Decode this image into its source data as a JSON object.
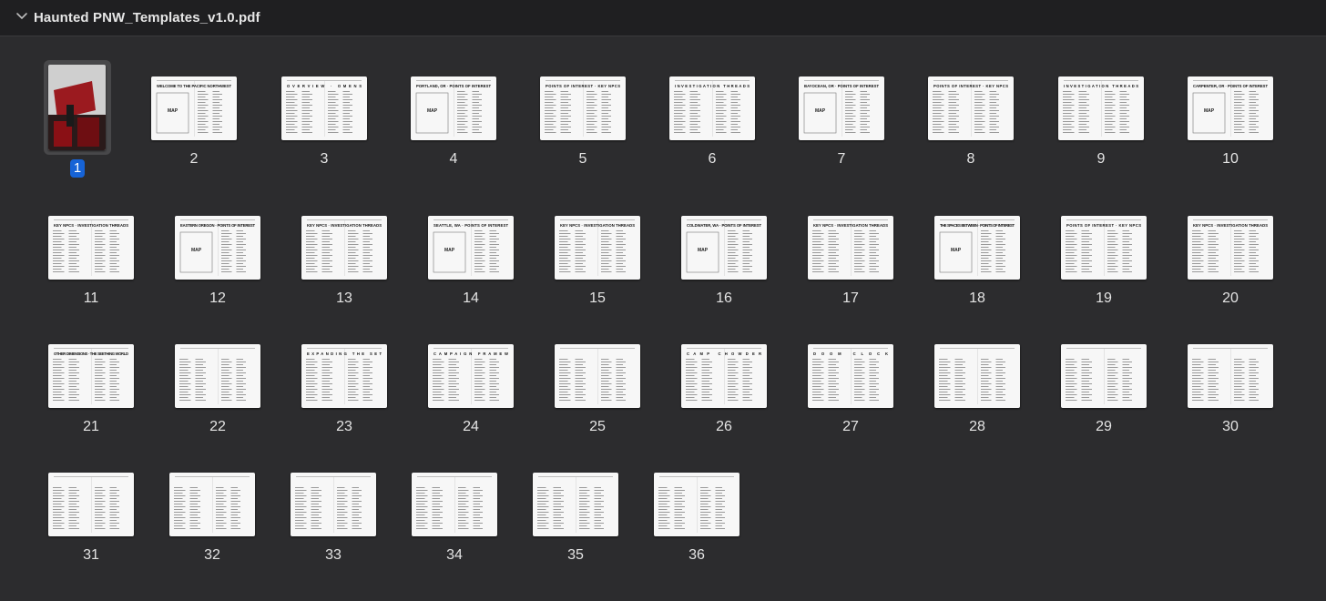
{
  "header": {
    "title": "Haunted PNW_Templates_v1.0.pdf"
  },
  "selected_page": "1",
  "pages": [
    {
      "label": "1",
      "heading": "",
      "map": false
    },
    {
      "label": "2",
      "heading": "WELCOME TO THE PACIFIC NORTHWEST",
      "map": true
    },
    {
      "label": "3",
      "heading": "OVERVIEW · OMENS",
      "map": false
    },
    {
      "label": "4",
      "heading": "PORTLAND, OR · POINTS OF INTEREST",
      "map": true
    },
    {
      "label": "5",
      "heading": "POINTS OF INTEREST · KEY NPCS",
      "map": false
    },
    {
      "label": "6",
      "heading": "INVESTIGATION THREADS",
      "map": false
    },
    {
      "label": "7",
      "heading": "BAYOCEAN, OR · POINTS OF INTEREST",
      "map": true
    },
    {
      "label": "8",
      "heading": "POINTS OF INTEREST · KEY NPCS",
      "map": false
    },
    {
      "label": "9",
      "heading": "INVESTIGATION THREADS",
      "map": false
    },
    {
      "label": "10",
      "heading": "CARPENTER, OR · POINTS OF INTEREST",
      "map": true
    },
    {
      "label": "11",
      "heading": "KEY NPCS · INVESTIGATION THREADS",
      "map": false
    },
    {
      "label": "12",
      "heading": "EASTERN OREGON · POINTS OF INTEREST",
      "map": true
    },
    {
      "label": "13",
      "heading": "KEY NPCS · INVESTIGATION THREADS",
      "map": false
    },
    {
      "label": "14",
      "heading": "SEATTLE, WA · POINTS OF INTEREST",
      "map": true
    },
    {
      "label": "15",
      "heading": "KEY NPCS · INVESTIGATION THREADS",
      "map": false
    },
    {
      "label": "16",
      "heading": "COLDWATER, WA · POINTS OF INTEREST",
      "map": true
    },
    {
      "label": "17",
      "heading": "KEY NPCS · INVESTIGATION THREADS",
      "map": false
    },
    {
      "label": "18",
      "heading": "THE SPACES BETWEEN · POINTS OF INTEREST",
      "map": true
    },
    {
      "label": "19",
      "heading": "POINTS OF INTEREST · KEY NPCS",
      "map": false
    },
    {
      "label": "20",
      "heading": "KEY NPCS · INVESTIGATION THREADS",
      "map": false
    },
    {
      "label": "21",
      "heading": "OTHER DIMENSIONS · THE SEETHING WORLD",
      "map": false
    },
    {
      "label": "22",
      "heading": "",
      "map": false
    },
    {
      "label": "23",
      "heading": "EXPANDING THE SET",
      "map": false
    },
    {
      "label": "24",
      "heading": "CAMPAIGN FRAMEW",
      "map": false
    },
    {
      "label": "25",
      "heading": "",
      "map": false
    },
    {
      "label": "26",
      "heading": "CAMP CHOWDER",
      "map": false
    },
    {
      "label": "27",
      "heading": "DOOM CLOCK",
      "map": false
    },
    {
      "label": "28",
      "heading": "",
      "map": false
    },
    {
      "label": "29",
      "heading": "",
      "map": false
    },
    {
      "label": "30",
      "heading": "",
      "map": false
    },
    {
      "label": "31",
      "heading": "",
      "map": false
    },
    {
      "label": "32",
      "heading": "",
      "map": false
    },
    {
      "label": "33",
      "heading": "",
      "map": false
    },
    {
      "label": "34",
      "heading": "",
      "map": false
    },
    {
      "label": "35",
      "heading": "",
      "map": false
    },
    {
      "label": "36",
      "heading": "",
      "map": false
    }
  ],
  "map_label": "MAP",
  "colors": {
    "background": "#2c2c2e",
    "header": "#1f1f21",
    "selection": "#1663d6",
    "cover_red": "#9b1a1f"
  },
  "icons": {
    "collapse": "chevron-down-icon"
  }
}
